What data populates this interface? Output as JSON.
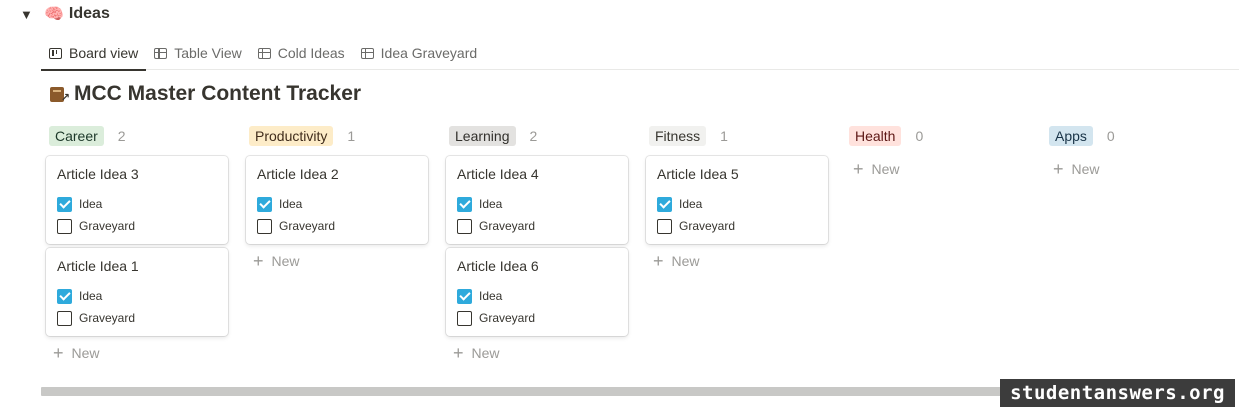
{
  "section": {
    "arrow": "▼",
    "icon": "🧠",
    "title": "Ideas"
  },
  "tabs": [
    {
      "label": "Board view",
      "icon": "board-icon",
      "active": true
    },
    {
      "label": "Table View",
      "icon": "table-icon"
    },
    {
      "label": "Cold Ideas",
      "icon": "table-icon"
    },
    {
      "label": "Idea Graveyard",
      "icon": "table-icon"
    }
  ],
  "database": {
    "title": "MCC Master Content Tracker",
    "icon": "book-arrow-icon"
  },
  "new_label": "New",
  "columns": [
    {
      "name": "Career",
      "count": "2",
      "tag_bg": "#dbeddb",
      "tag_color": "#1c3829",
      "cards": [
        {
          "title": "Article Idea 3",
          "props": [
            {
              "label": "Idea",
              "checked": true
            },
            {
              "label": "Graveyard",
              "checked": false
            }
          ]
        },
        {
          "title": "Article Idea 1",
          "props": [
            {
              "label": "Idea",
              "checked": true
            },
            {
              "label": "Graveyard",
              "checked": false
            }
          ]
        }
      ]
    },
    {
      "name": "Productivity",
      "count": "1",
      "tag_bg": "#fdecc8",
      "tag_color": "#402c1b",
      "cards": [
        {
          "title": "Article Idea 2",
          "props": [
            {
              "label": "Idea",
              "checked": true
            },
            {
              "label": "Graveyard",
              "checked": false
            }
          ]
        }
      ]
    },
    {
      "name": "Learning",
      "count": "2",
      "tag_bg": "#e3e2e0",
      "tag_color": "#32302c",
      "cards": [
        {
          "title": "Article Idea 4",
          "props": [
            {
              "label": "Idea",
              "checked": true
            },
            {
              "label": "Graveyard",
              "checked": false
            }
          ]
        },
        {
          "title": "Article Idea 6",
          "props": [
            {
              "label": "Idea",
              "checked": true
            },
            {
              "label": "Graveyard",
              "checked": false
            }
          ]
        }
      ]
    },
    {
      "name": "Fitness",
      "count": "1",
      "tag_bg": "#f1f1ef",
      "tag_color": "#37352f",
      "cards": [
        {
          "title": "Article Idea 5",
          "props": [
            {
              "label": "Idea",
              "checked": true
            },
            {
              "label": "Graveyard",
              "checked": false
            }
          ]
        }
      ]
    },
    {
      "name": "Health",
      "count": "0",
      "tag_bg": "#ffe2dd",
      "tag_color": "#5d1715",
      "cards": []
    },
    {
      "name": "Apps",
      "count": "0",
      "tag_bg": "#d3e5ef",
      "tag_color": "#183347",
      "cards": []
    }
  ],
  "watermark": "studentanswers.org"
}
